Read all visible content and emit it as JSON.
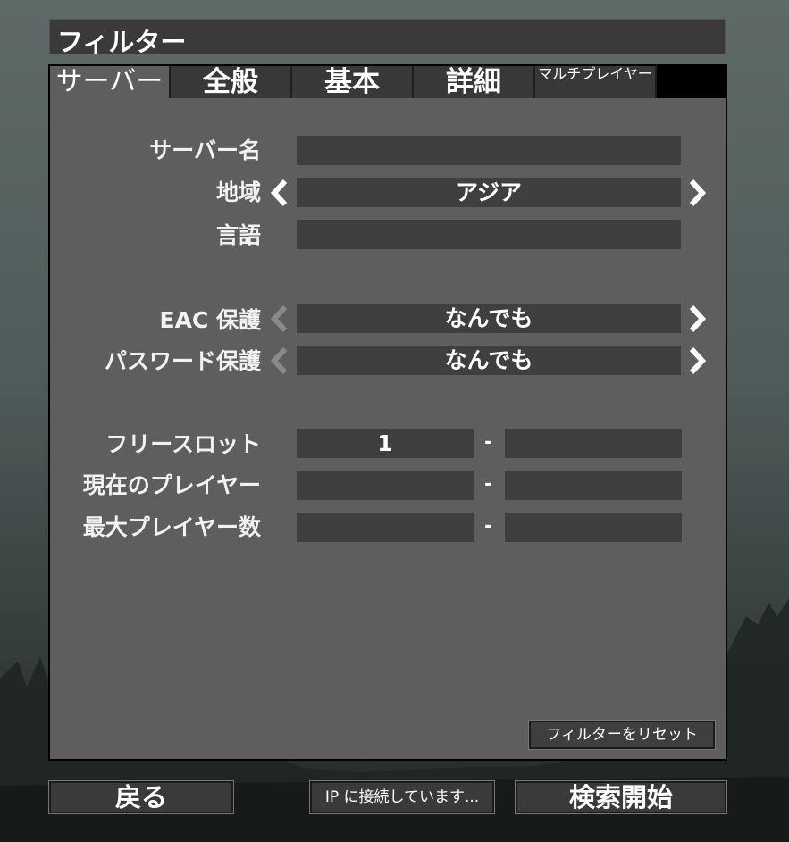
{
  "window": {
    "title": "フィルター"
  },
  "tabs": [
    {
      "label": "サーバー",
      "active": true
    },
    {
      "label": "全般"
    },
    {
      "label": "基本"
    },
    {
      "label": "詳細"
    },
    {
      "label": "マルチプレイヤー"
    }
  ],
  "server": {
    "name_label": "サーバー名",
    "name_value": "",
    "region_label": "地域",
    "region_value": "アジア",
    "language_label": "言語",
    "language_value": "",
    "eac_label": "EAC 保護",
    "eac_value": "なんでも",
    "password_label": "パスワード保護",
    "password_value": "なんでも",
    "free_slots_label": "フリースロット",
    "free_slots_min": "1",
    "free_slots_max": "",
    "current_players_label": "現在のプレイヤー",
    "current_players_min": "",
    "current_players_max": "",
    "max_players_label": "最大プレイヤー数",
    "max_players_min": "",
    "max_players_max": "",
    "range_separator": "-"
  },
  "reset_label": "フィルターをリセット",
  "bottom": {
    "back_label": "戻る",
    "connect_ip_label": "IP に接続しています...",
    "search_label": "検索開始"
  },
  "colors": {
    "panel_bg": "#5e5e5e",
    "field_bg": "#3f3f3f",
    "tab_bg": "#383838",
    "disabled_arrow": "#8a8a8a",
    "enabled_arrow": "#ffffff"
  },
  "icons": {
    "left_arrow": "chevron-left-icon",
    "right_arrow": "chevron-right-icon"
  }
}
